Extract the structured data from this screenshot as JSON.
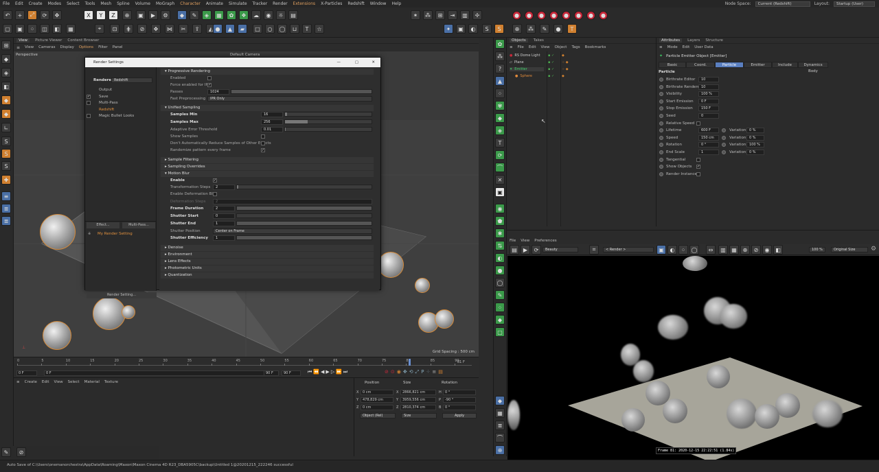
{
  "menubar": {
    "items": [
      "File",
      "Edit",
      "Create",
      "Modes",
      "Select",
      "Tools",
      "Mesh",
      "Spline",
      "Volume",
      "MoGraph",
      "Character",
      "Animate",
      "Simulate",
      "Tracker",
      "Render",
      "Extensions",
      "X-Particles",
      "Redshift",
      "Window",
      "Help"
    ],
    "node_space_label": "Node Space:",
    "node_space_value": "Current (Redshift)",
    "layout_label": "Layout:",
    "layout_value": "Startup (User)"
  },
  "viewport": {
    "tabs": [
      "View",
      "Picture Viewer",
      "Content Browser"
    ],
    "menu": [
      "View",
      "Cameras",
      "Display",
      "Options",
      "Filter",
      "Panel"
    ],
    "projection": "Perspective",
    "camera": "Default Camera",
    "grid_spacing": "Grid Spacing : 500 cm"
  },
  "render_settings": {
    "title": "Render Settings",
    "renderer_label": "Renderer",
    "renderer_value": "Redshift",
    "tree": [
      "Output",
      "Save",
      "Multi-Pass",
      "Redshift",
      "Magic Bullet Looks"
    ],
    "effect_button": "Effect...",
    "multipass_button": "Multi-Pass...",
    "preset_name": "My Render Setting",
    "render_setting_button": "Render Setting...",
    "progressive": {
      "header": "Progressive Rendering",
      "enabled_label": "Enabled",
      "force_ipr_label": "Force enabled for IPR",
      "passes_label": "Passes",
      "passes_value": "1024",
      "fast_preprocessing_label": "Fast Preprocessing",
      "fast_preprocessing_value": "IPR Only"
    },
    "unified": {
      "header": "Unified Sampling",
      "samples_min_label": "Samples Min",
      "samples_min_value": "16",
      "samples_max_label": "Samples Max",
      "samples_max_value": "256",
      "adaptive_label": "Adaptive Error Threshold",
      "adaptive_value": "0.01",
      "show_samples_label": "Show Samples",
      "dont_reduce_label": "Don't Automatically Reduce Samples of Other Effects",
      "randomize_label": "Randomize pattern every frame"
    },
    "sample_filtering": "Sample Filtering",
    "sampling_overrides": "Sampling Overrides",
    "motion_blur": {
      "header": "Motion Blur",
      "enable_label": "Enable",
      "transformation_steps_label": "Transformation Steps",
      "transformation_steps_value": "2",
      "enable_deformation_label": "Enable Deformation Blur",
      "deformation_steps_label": "Deformation Steps",
      "deformation_steps_value": "2",
      "frame_duration_label": "Frame Duration",
      "frame_duration_value": "2",
      "shutter_start_label": "Shutter Start",
      "shutter_start_value": "0",
      "shutter_end_label": "Shutter End",
      "shutter_end_value": "1",
      "shutter_position_label": "Shutter Position",
      "shutter_position_value": "Center on Frame",
      "shutter_efficiency_label": "Shutter Efficiency",
      "shutter_efficiency_value": "1"
    },
    "collapsed_sections": [
      "Denoise",
      "Environment",
      "Lens Effects",
      "Photometric Units",
      "Quantization"
    ]
  },
  "timeline": {
    "ticks": [
      "0",
      "5",
      "10",
      "15",
      "20",
      "25",
      "30",
      "35",
      "40",
      "45",
      "50",
      "55",
      "60",
      "65",
      "70",
      "75",
      "80",
      "85",
      "90"
    ],
    "current_frame": "81",
    "end_frame": "81 F",
    "start_field": "0 F",
    "start_field2": "0 F",
    "max_field": "90 F",
    "max_field2": "90 F"
  },
  "material_panel": {
    "menu": [
      "Create",
      "Edit",
      "View",
      "Select",
      "Material",
      "Texture"
    ]
  },
  "coordinates": {
    "headers": [
      "Position",
      "Size",
      "Rotation"
    ],
    "rows": [
      {
        "axis": "X",
        "pos": "0 cm",
        "size_axis": "X",
        "size": "2866,821 cm",
        "rot_axis": "H",
        "rot": "0 °"
      },
      {
        "axis": "Y",
        "pos": "478,829 cm",
        "size_axis": "Y",
        "size": "3959,556 cm",
        "rot_axis": "P",
        "rot": "-90 °"
      },
      {
        "axis": "Z",
        "pos": "0 cm",
        "size_axis": "Z",
        "size": "2810,374 cm",
        "rot_axis": "B",
        "rot": "0 °"
      }
    ],
    "mode": "Object (Rel)",
    "size_mode": "Size",
    "apply": "Apply"
  },
  "objects_panel": {
    "tabs": [
      "Objects",
      "Takes"
    ],
    "menu": [
      "File",
      "Edit",
      "View",
      "Object",
      "Tags",
      "Bookmarks"
    ],
    "items": [
      {
        "name": "RS Dome Light",
        "color": "#cfcfcf"
      },
      {
        "name": "Plane",
        "color": "#cfcfcf"
      },
      {
        "name": "Emitter",
        "color": "#3fd06a"
      },
      {
        "name": "Sphere",
        "color": "#e08a3a"
      }
    ]
  },
  "attributes": {
    "tabs": [
      "Attributes",
      "Layers",
      "Structure"
    ],
    "menu": [
      "Mode",
      "Edit",
      "User Data"
    ],
    "object_title": "Particle Emitter Object [Emitter]",
    "subtabs": [
      "Basic",
      "Coord.",
      "Particle",
      "Emitter",
      "Include",
      "Dynamics Body"
    ],
    "section": "Particle",
    "rows": [
      {
        "label": "Birthrate Editor",
        "value": "10"
      },
      {
        "label": "Birthrate Renderer",
        "value": "10"
      },
      {
        "label": "Visibility",
        "value": "100 %"
      },
      {
        "label": "Start Emission",
        "value": "0 F"
      },
      {
        "label": "Stop Emission",
        "value": "150 F"
      },
      {
        "label": "Seed",
        "value": "0"
      },
      {
        "label": "Relative Speed",
        "value": ""
      },
      {
        "label": "Lifetime",
        "value": "600 F",
        "var": "0 %"
      },
      {
        "label": "Speed",
        "value": "150 cm",
        "var": "0 %"
      },
      {
        "label": "Rotation",
        "value": "0 °",
        "var": "100 %"
      },
      {
        "label": "End Scale",
        "value": "1",
        "var": "0 %"
      },
      {
        "label": "Tangential",
        "value": ""
      },
      {
        "label": "Show Objects",
        "value": ""
      },
      {
        "label": "Render Instance",
        "value": ""
      }
    ],
    "variation_label": "Variation"
  },
  "render_view": {
    "menu": [
      "File",
      "View",
      "Preferences"
    ],
    "aov": "Beauty",
    "render_label": "< Render >",
    "zoom": "100 %",
    "size_mode": "Original Size",
    "frame_stamp": "Frame 81: 2020-12-15 22:22:51 (1.84s)"
  },
  "status": {
    "message": "Auto Save of C:\\Users\\onemanorchestra\\AppData\\Roaming\\Maxon\\Maxon Cinema 4D R23_DBA5905C\\backup\\Untitled 1@20201215_222246 successful"
  },
  "colors": {
    "accent_blue": "#5a7fc0",
    "selection_orange": "#d48a3a",
    "emitter_green": "#3fd06a",
    "record_red": "#c8283a"
  }
}
